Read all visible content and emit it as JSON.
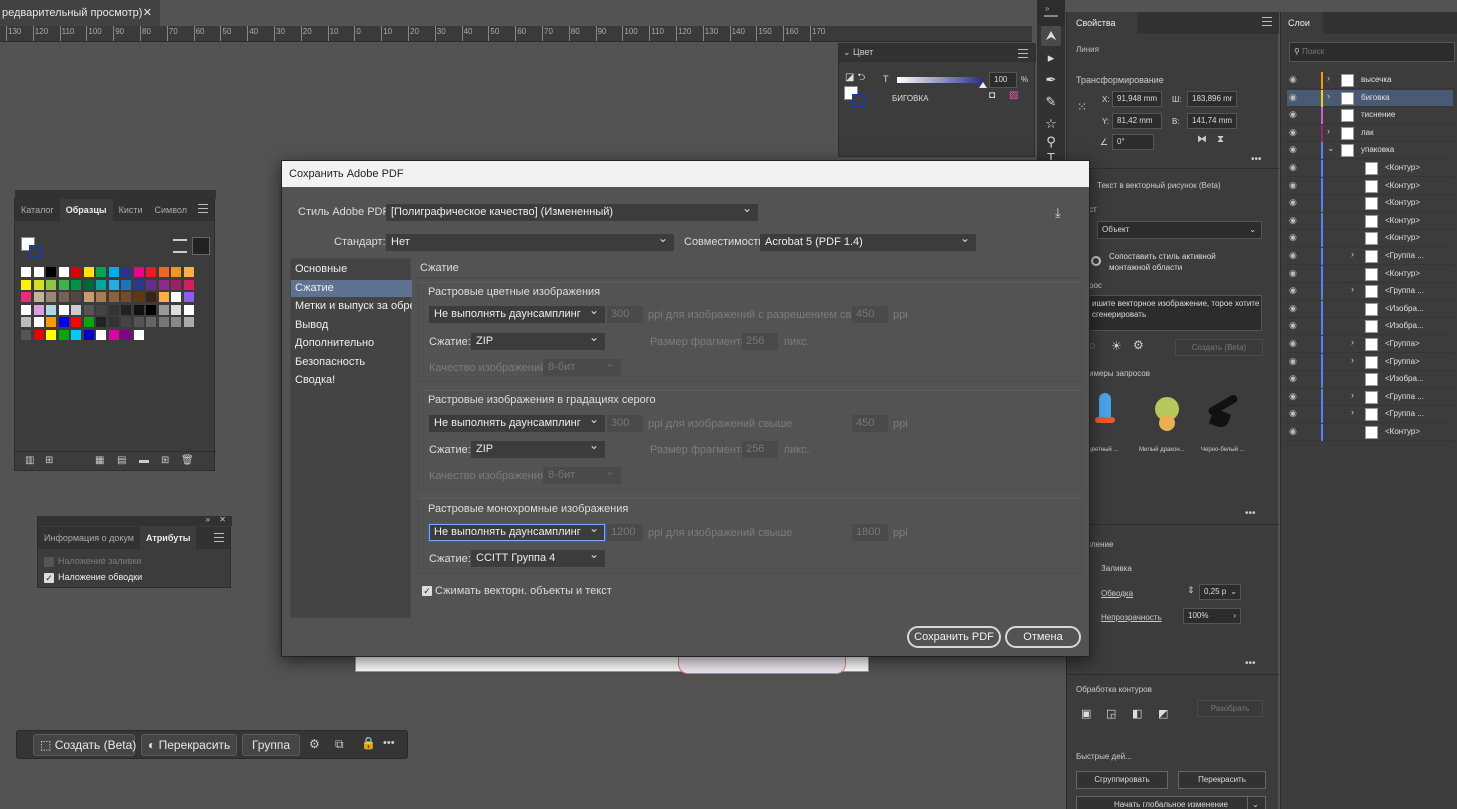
{
  "doc_tab": {
    "title": "редварительный просмотр)",
    "close": "✕"
  },
  "ruler": {
    "ticks": [
      "130",
      "120",
      "110",
      "100",
      "90",
      "80",
      "70",
      "60",
      "50",
      "40",
      "30",
      "20",
      "10",
      "0",
      "10",
      "20",
      "30",
      "40",
      "50",
      "60",
      "70",
      "80",
      "90",
      "100",
      "110",
      "120",
      "130",
      "140",
      "150",
      "160",
      "170"
    ]
  },
  "left_panels": {
    "swatches": {
      "tabs": [
        "Каталог",
        "Образцы",
        "Кисти",
        "Символ"
      ],
      "active_tab": "Образцы"
    },
    "attributes": {
      "tabs": [
        "Информация о докум",
        "Атрибуты"
      ],
      "active_tab": "Атрибуты",
      "overprint_fill": "Наложение заливки",
      "overprint_stroke": "Наложение обводки"
    }
  },
  "color_panel": {
    "title": "Цвет",
    "tint_label": "T",
    "value": "100",
    "unit": "%",
    "swatch_name": "БИГОВКА"
  },
  "properties": {
    "title": "Свойства",
    "object_type": "Линия",
    "transform_title": "Трансформирование",
    "x_label": "X:",
    "x": "91,948 mm",
    "w_label": "Ш:",
    "w": "183,896 mr",
    "y_label": "Y:",
    "y": "81,42 mm",
    "h_label": "В:",
    "h": "141,74 mm",
    "angle": "0°",
    "vector_section": "Текст в векторный рисунок (Beta)",
    "object_label": "ст",
    "object_value": "Объект",
    "match_style": "Сопоставить стиль активной монтажной области",
    "prompt_label": "рос",
    "prompt_placeholder": "ишите векторное изображение, торое хотите сгенерировать",
    "generate": "Создать (Beta)",
    "examples_title": "имеры запросов",
    "examples": [
      "оцветный ...",
      "Милый дракон...",
      "Черно-белый ..."
    ],
    "appearance_title": "рмление",
    "fill_label": "Заливка",
    "stroke_label": "Обводка",
    "stroke_value": "0,25 p",
    "opacity_label": "Непрозрачность",
    "opacity_value": "100%",
    "pathfinder_title": "Обработка контуров",
    "expand": "Разобрать",
    "quick_actions": "Быстрые дей...",
    "group_btn": "Сгруппировать",
    "recolor_btn": "Перекрасить",
    "global_edit": "Начать глобальное изменение"
  },
  "layers": {
    "title": "Слои",
    "search_placeholder": "Поиск",
    "rows": [
      {
        "name": "высечка",
        "color": "#ff9900",
        "arrow": "›",
        "level": 0
      },
      {
        "name": "биговка",
        "color": "#f5d300",
        "arrow": "›",
        "level": 0,
        "selected": true
      },
      {
        "name": "тиснение",
        "color": "#d25ad2",
        "arrow": "",
        "level": 0
      },
      {
        "name": "лак",
        "color": "#a0246e",
        "arrow": "›",
        "level": 0
      },
      {
        "name": "упаковка",
        "color": "#5a7dff",
        "arrow": "⌄",
        "level": 0
      },
      {
        "name": "<Контур>",
        "color": "#5a7dff",
        "arrow": "",
        "level": 1
      },
      {
        "name": "<Контур>",
        "color": "#5a7dff",
        "arrow": "",
        "level": 1
      },
      {
        "name": "<Контур>",
        "color": "#5a7dff",
        "arrow": "",
        "level": 1
      },
      {
        "name": "<Контур>",
        "color": "#5a7dff",
        "arrow": "",
        "level": 1
      },
      {
        "name": "<Контур>",
        "color": "#5a7dff",
        "arrow": "",
        "level": 1
      },
      {
        "name": "<Группа ...",
        "color": "#5a7dff",
        "arrow": "›",
        "level": 1
      },
      {
        "name": "<Контур>",
        "color": "#5a7dff",
        "arrow": "",
        "level": 1
      },
      {
        "name": "<Группа ...",
        "color": "#5a7dff",
        "arrow": "›",
        "level": 1
      },
      {
        "name": "<Изобра...",
        "color": "#5a7dff",
        "arrow": "",
        "level": 1
      },
      {
        "name": "<Изобра...",
        "color": "#5a7dff",
        "arrow": "",
        "level": 1
      },
      {
        "name": "<Группа>",
        "color": "#5a7dff",
        "arrow": "›",
        "level": 1
      },
      {
        "name": "<Группа>",
        "color": "#5a7dff",
        "arrow": "›",
        "level": 1
      },
      {
        "name": "<Изобра...",
        "color": "#5a7dff",
        "arrow": "",
        "level": 1
      },
      {
        "name": "<Группа ...",
        "color": "#5a7dff",
        "arrow": "›",
        "level": 1
      },
      {
        "name": "<Группа ...",
        "color": "#5a7dff",
        "arrow": "›",
        "level": 1
      },
      {
        "name": "<Контур>",
        "color": "#5a7dff",
        "arrow": "",
        "level": 1
      }
    ]
  },
  "dialog": {
    "title": "Сохранить Adobe PDF",
    "style_label": "Стиль Adobe PDF:",
    "style_value": "[Полиграфическое качество] (Измененный)",
    "standard_label": "Стандарт:",
    "standard_value": "Нет",
    "compat_label": "Совместимость:",
    "compat_value": "Acrobat 5 (PDF 1.4)",
    "nav": [
      "Основные",
      "Сжатие",
      "Метки и выпуск за обрез",
      "Вывод",
      "Дополнительно",
      "Безопасность",
      "Сводка!"
    ],
    "active_nav": "Сжатие",
    "section_title": "Сжатие",
    "color_images": {
      "title": "Растровые цветные изображения",
      "downsample": "Не выполнять даунсамплинг",
      "ppi1": "300",
      "ppi_text": "ppi для изображений с разрешением свыше",
      "ppi2": "450",
      "ppi_unit": "ppi",
      "compression_label": "Сжатие:",
      "compression": "ZIP",
      "tile_label": "Размер фрагмента:",
      "tile": "256",
      "tile_unit": "пикс.",
      "quality_label": "Качество изображений:",
      "quality": "8-бит"
    },
    "gray_images": {
      "title": "Растровые изображения в градациях серого",
      "downsample": "Не выполнять даунсамплинг",
      "ppi1": "300",
      "ppi_text": "ppi для изображений свыше",
      "ppi2": "450",
      "ppi_unit": "ppi",
      "compression_label": "Сжатие:",
      "compression": "ZIP",
      "tile_label": "Размер фрагмента:",
      "tile": "256",
      "tile_unit": "пикс.",
      "quality_label": "Качество изображения:",
      "quality": "8-бит"
    },
    "mono_images": {
      "title": "Растровые монохромные изображения",
      "downsample": "Не выполнять даунсамплинг",
      "ppi1": "1200",
      "ppi_text": "ppi для изображений свыше",
      "ppi2": "1800",
      "ppi_unit": "ppi",
      "compression_label": "Сжатие:",
      "compression": "CCITT Группа 4"
    },
    "compress_text": "Сжимать векторн. объекты и текст",
    "save_btn": "Сохранить PDF",
    "cancel_btn": "Отмена"
  },
  "bottom_bar": {
    "create": "Создать (Beta)",
    "recolor": "Перекрасить",
    "group": "Группа",
    "more": "•••"
  }
}
